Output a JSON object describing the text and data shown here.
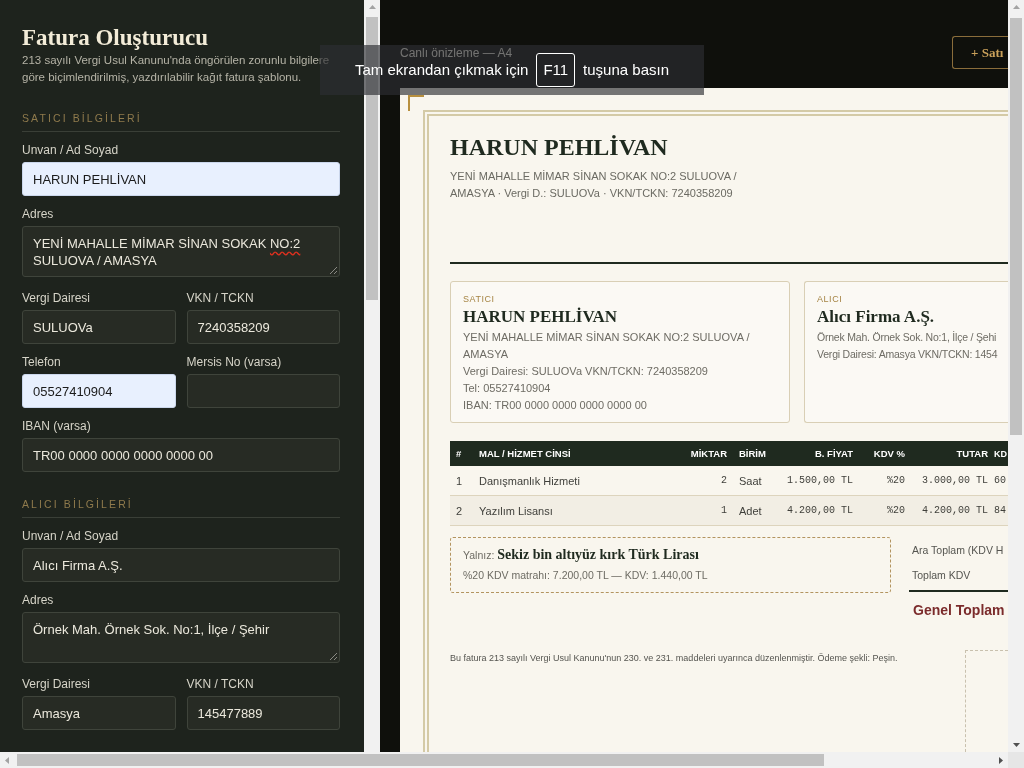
{
  "sidebar": {
    "title": "Fatura Oluşturucu",
    "description": "213 sayılı Vergi Usul Kanunu'nda öngörülen zorunlu bilgilere göre biçimlendirilmiş, yazdırılabilir kağıt fatura şablonu.",
    "sections": [
      {
        "heading": "SATICI BİLGİLERİ",
        "rows": [
          [
            {
              "label": "Unvan / Ad Soyad",
              "kind": "input",
              "value": "HARUN PEHLİVAN",
              "autofilled": true
            }
          ],
          [
            {
              "label": "Adres",
              "kind": "textarea",
              "value_parts": [
                {
                  "text": "YENİ MAHALLE MİMAR SİNAN SOKAK ",
                  "misspelled": false
                },
                {
                  "text": "NO:2",
                  "misspelled": true
                },
                {
                  "text": " SULUOVA / AMASYA",
                  "misspelled": false
                }
              ],
              "autofilled": false
            }
          ],
          [
            {
              "label": "Vergi Dairesi",
              "kind": "input",
              "value": "SULUOVa",
              "autofilled": false
            },
            {
              "label": "VKN / TCKN",
              "kind": "input",
              "value": "7240358209",
              "autofilled": false
            }
          ],
          [
            {
              "label": "Telefon",
              "kind": "input",
              "value": "05527410904",
              "autofilled": true
            },
            {
              "label": "Mersis No (varsa)",
              "kind": "input",
              "autofilled": false
            }
          ],
          [
            {
              "label": "IBAN (varsa)",
              "kind": "input",
              "value": "TR00 0000 0000 0000 0000 00",
              "autofilled": false
            }
          ]
        ]
      },
      {
        "heading": "ALICI BİLGİLERİ",
        "rows": [
          [
            {
              "label": "Unvan / Ad Soyad",
              "kind": "input",
              "value": "Alıcı Firma A.Ş.",
              "autofilled": false
            }
          ],
          [
            {
              "label": "Adres",
              "kind": "textarea",
              "value_parts": [
                {
                  "text": "Örnek Mah. Örnek Sok. No:1, İlçe / Şehir",
                  "misspelled": false
                }
              ],
              "autofilled": false
            }
          ],
          [
            {
              "label": "Vergi Dairesi",
              "kind": "input",
              "value": "Amasya",
              "autofilled": false
            },
            {
              "label": "VKN / TCKN",
              "kind": "input",
              "value": "145477889",
              "autofilled": false
            }
          ]
        ]
      }
    ]
  },
  "preview": {
    "caption": "Canlı önizleme — A4",
    "add_row_button": "+ Satı",
    "invoice": {
      "issuer": {
        "name": "HARUN PEHLİVAN",
        "details": "YENİ MAHALLE MİMAR SİNAN SOKAK NO:2 SULUOVA / AMASYA · Vergi D.: SULUOVa · VKN/TCKN: 7240358209"
      },
      "parties": [
        {
          "label": "SATICI",
          "name": "HARUN PEHLİVAN",
          "lines": [
            "YENİ MAHALLE MİMAR SİNAN SOKAK NO:2 SULUOVA / AMASYA",
            "Vergi Dairesi: SULUOVa VKN/TCKN: 7240358209",
            "Tel: 05527410904",
            "IBAN: TR00 0000 0000 0000 0000 00"
          ]
        },
        {
          "label": "ALICI",
          "name": "Alıcı Firma A.Ş.",
          "lines": [
            "Örnek Mah. Örnek Sok. No:1, İlçe / Şehi",
            "Vergi Dairesi: Amasya VKN/TCKN: 1454"
          ]
        }
      ],
      "table": {
        "columns": [
          {
            "label": "#",
            "kind": "index"
          },
          {
            "label": "MAL / HİZMET CİNSİ",
            "kind": "text"
          },
          {
            "label": "MİKTAR",
            "kind": "number"
          },
          {
            "label": "BİRİM",
            "kind": "text"
          },
          {
            "label": "B. FİYAT",
            "kind": "number"
          },
          {
            "label": "KDV %",
            "kind": "number"
          },
          {
            "label": "TUTAR",
            "kind": "number"
          },
          {
            "label": "KD",
            "kind": "number"
          }
        ],
        "rows": [
          [
            "1",
            "Danışmanlık Hizmeti",
            "2",
            "Saat",
            "1.500,00 TL",
            "%20",
            "3.000,00 TL",
            "60"
          ],
          [
            "2",
            "Yazılım Lisansı",
            "1",
            "Adet",
            "4.200,00 TL",
            "%20",
            "4.200,00 TL",
            "84"
          ]
        ]
      },
      "amount_in_words": {
        "text": "Yalnız: **Sekiz bin altıyüz kırk Türk Lirası**",
        "tax_summary": "%20 KDV matrahı: 7.200,00 TL — KDV: 1.440,00 TL"
      },
      "totals": [
        {
          "label": "Ara Toplam (KDV H",
          "kind": "subtotal"
        },
        {
          "label": "Toplam KDV",
          "kind": "subtotal"
        },
        {
          "label": "Genel Toplam",
          "kind": "grand"
        }
      ],
      "footer_note": "Bu fatura 213 sayılı Vergi Usul Kanunu'nun 230. ve 231. maddeleri uyarınca düzenlenmiştir. Ödeme şekli: Peşin."
    }
  },
  "fullscreen_notice": {
    "before": "Tam ekrandan çıkmak için",
    "key": "F11",
    "after": "tuşuna basın"
  }
}
